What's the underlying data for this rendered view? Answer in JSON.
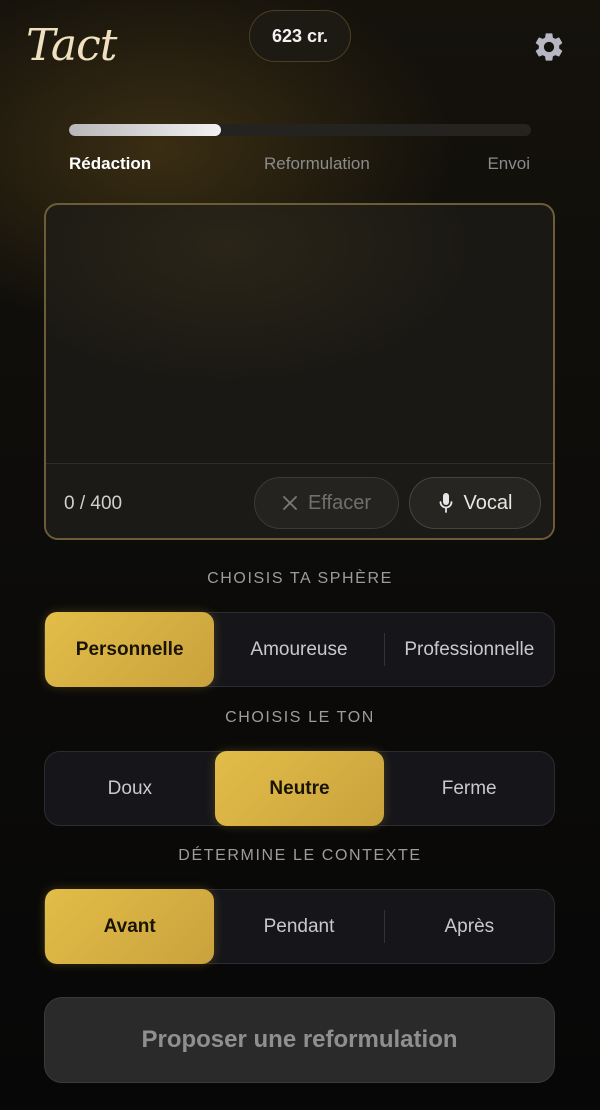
{
  "header": {
    "logo_text": "Tact",
    "credits": "623 cr.",
    "settings_icon": "gear-icon"
  },
  "progress": {
    "value": 0.33,
    "steps": [
      "Rédaction",
      "Reformulation",
      "Envoi"
    ],
    "active_step": 0
  },
  "editor": {
    "value": "",
    "counter": "0 / 400",
    "clear_label": "Effacer",
    "voice_label": "Vocal",
    "clear_icon": "close-icon",
    "voice_icon": "microphone-icon"
  },
  "sphere": {
    "label": "CHOISIS TA SPHÈRE",
    "options": [
      "Personnelle",
      "Amoureuse",
      "Professionnelle"
    ],
    "selected": "Personnelle"
  },
  "tone": {
    "label": "CHOISIS LE TON",
    "options": [
      "Doux",
      "Neutre",
      "Ferme"
    ],
    "selected": "Neutre"
  },
  "context": {
    "label": "DÉTERMINE LE CONTEXTE",
    "options": [
      "Avant",
      "Pendant",
      "Après"
    ],
    "selected": "Avant"
  },
  "cta": {
    "label": "Proposer une reformulation"
  },
  "colors": {
    "accent_gold": "#d9b545",
    "border_gold": "#6d5d36",
    "background": "#0a0a0a"
  }
}
